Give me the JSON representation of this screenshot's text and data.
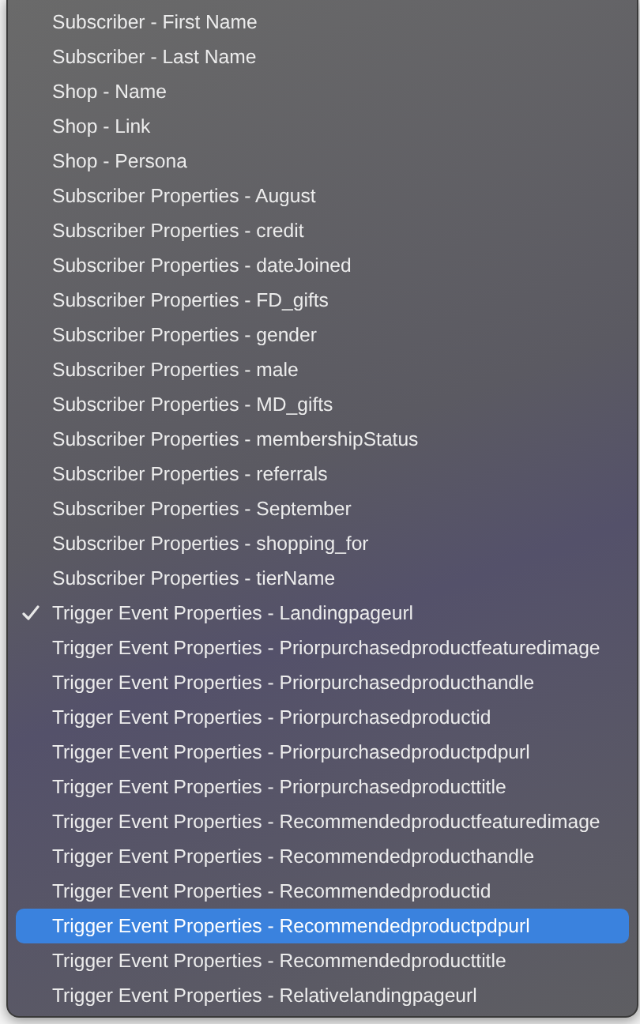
{
  "menu": {
    "items": [
      {
        "label": "Subscriber - First Name",
        "checked": false,
        "selected": false
      },
      {
        "label": "Subscriber - Last Name",
        "checked": false,
        "selected": false
      },
      {
        "label": "Shop - Name",
        "checked": false,
        "selected": false
      },
      {
        "label": "Shop - Link",
        "checked": false,
        "selected": false
      },
      {
        "label": "Shop - Persona",
        "checked": false,
        "selected": false
      },
      {
        "label": "Subscriber Properties - August",
        "checked": false,
        "selected": false
      },
      {
        "label": "Subscriber Properties - credit",
        "checked": false,
        "selected": false
      },
      {
        "label": "Subscriber Properties - dateJoined",
        "checked": false,
        "selected": false
      },
      {
        "label": "Subscriber Properties - FD_gifts",
        "checked": false,
        "selected": false
      },
      {
        "label": "Subscriber Properties - gender",
        "checked": false,
        "selected": false
      },
      {
        "label": "Subscriber Properties - male",
        "checked": false,
        "selected": false
      },
      {
        "label": "Subscriber Properties - MD_gifts",
        "checked": false,
        "selected": false
      },
      {
        "label": "Subscriber Properties - membershipStatus",
        "checked": false,
        "selected": false
      },
      {
        "label": "Subscriber Properties - referrals",
        "checked": false,
        "selected": false
      },
      {
        "label": "Subscriber Properties - September",
        "checked": false,
        "selected": false
      },
      {
        "label": "Subscriber Properties - shopping_for",
        "checked": false,
        "selected": false
      },
      {
        "label": "Subscriber Properties - tierName",
        "checked": false,
        "selected": false
      },
      {
        "label": "Trigger Event Properties - Landingpageurl",
        "checked": true,
        "selected": false
      },
      {
        "label": "Trigger Event Properties - Priorpurchasedproductfeaturedimage",
        "checked": false,
        "selected": false
      },
      {
        "label": "Trigger Event Properties - Priorpurchasedproducthandle",
        "checked": false,
        "selected": false
      },
      {
        "label": "Trigger Event Properties - Priorpurchasedproductid",
        "checked": false,
        "selected": false
      },
      {
        "label": "Trigger Event Properties - Priorpurchasedproductpdpurl",
        "checked": false,
        "selected": false
      },
      {
        "label": "Trigger Event Properties - Priorpurchasedproducttitle",
        "checked": false,
        "selected": false
      },
      {
        "label": "Trigger Event Properties - Recommendedproductfeaturedimage",
        "checked": false,
        "selected": false
      },
      {
        "label": "Trigger Event Properties - Recommendedproducthandle",
        "checked": false,
        "selected": false
      },
      {
        "label": "Trigger Event Properties - Recommendedproductid",
        "checked": false,
        "selected": false
      },
      {
        "label": "Trigger Event Properties - Recommendedproductpdpurl",
        "checked": false,
        "selected": true
      },
      {
        "label": "Trigger Event Properties - Recommendedproducttitle",
        "checked": false,
        "selected": false
      },
      {
        "label": "Trigger Event Properties - Relativelandingpageurl",
        "checked": false,
        "selected": false
      }
    ]
  }
}
